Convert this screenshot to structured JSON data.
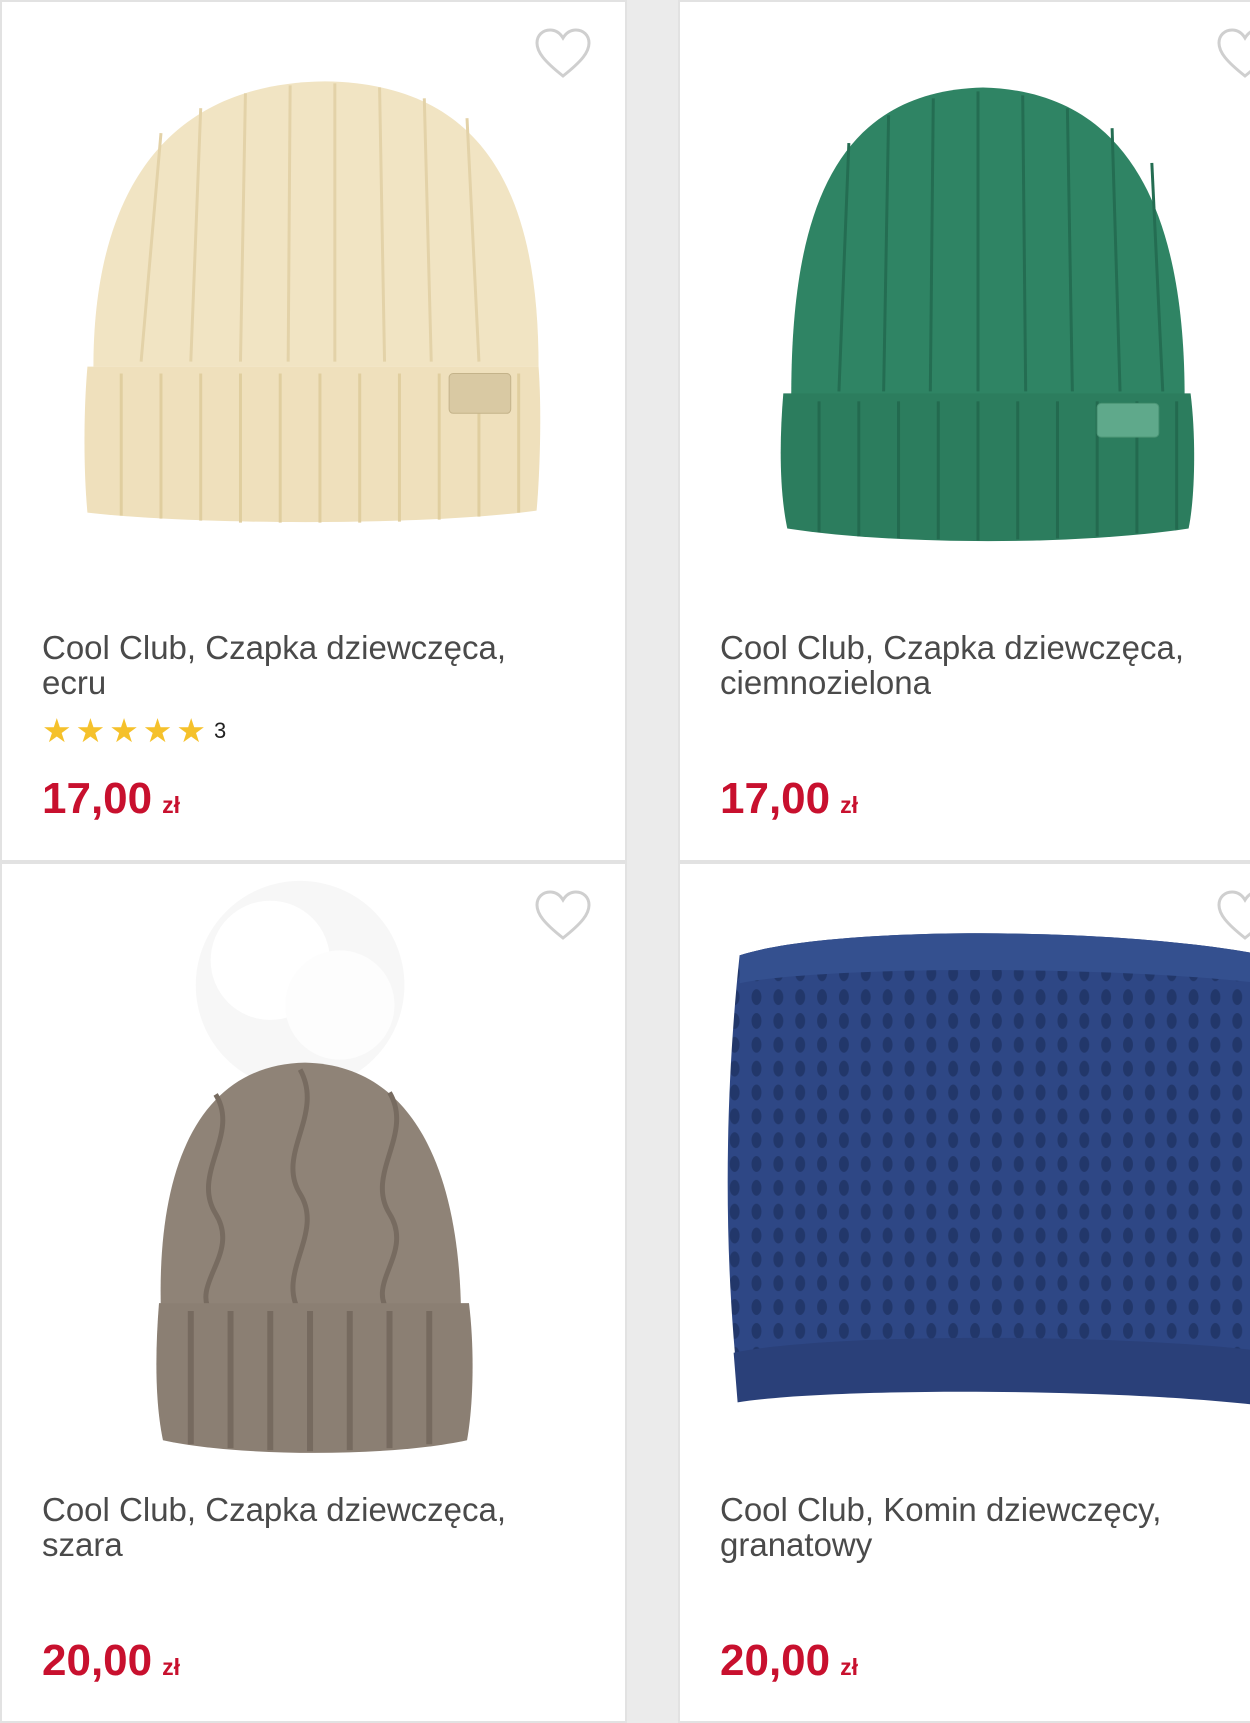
{
  "products": [
    {
      "title_line1": "Cool Club, Czapka dziewczęca,",
      "title_line2": "ecru",
      "rating_count": "3",
      "stars": 5,
      "price": "17,00",
      "currency": "zł",
      "colors": {
        "hat": "#f1e4c3",
        "hat_dark": "#e3d2a8"
      }
    },
    {
      "title_line1": "Cool Club, Czapka dziewczęca,",
      "title_line2": "ciemnozielona",
      "price": "17,00",
      "currency": "zł",
      "colors": {
        "hat": "#2f8464",
        "hat_dark": "#246d52"
      }
    },
    {
      "title_line1": "Cool Club, Czapka dziewczęca,",
      "title_line2": "szara",
      "price": "20,00",
      "currency": "zł",
      "colors": {
        "hat": "#8f8377",
        "hat_dark": "#776b60"
      }
    },
    {
      "title_line1": "Cool Club, Komin dziewczęcy,",
      "title_line2": "granatowy",
      "price": "20,00",
      "currency": "zł",
      "colors": {
        "hat": "#2e4785",
        "hat_dark": "#22376a"
      }
    }
  ],
  "accent_price": "#c8102e",
  "star_color": "#f5c12b",
  "icons": {
    "favorite": "heart-outline-icon",
    "rating": "star-icon"
  }
}
